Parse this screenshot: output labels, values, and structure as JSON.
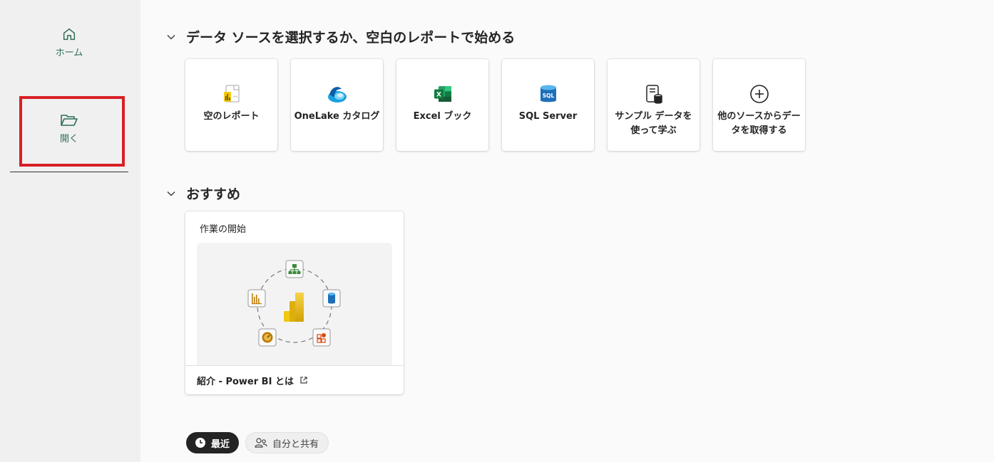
{
  "sidebar": {
    "items": [
      {
        "label": "ホーム",
        "icon": "home-icon"
      },
      {
        "label": "開く",
        "icon": "folder-open-icon"
      }
    ]
  },
  "sections": {
    "start": {
      "title": "データ ソースを選択するか、空白のレポートで始める"
    },
    "recommended": {
      "title": "おすすめ"
    }
  },
  "tiles": [
    {
      "label": "空のレポート",
      "icon": "blank-report-icon"
    },
    {
      "label": "OneLake カタログ",
      "icon": "onelake-icon"
    },
    {
      "label": "Excel ブック",
      "icon": "excel-icon"
    },
    {
      "label": "SQL Server",
      "icon": "sql-server-icon"
    },
    {
      "label": "サンプル データを使って学ぶ",
      "icon": "sample-data-icon"
    },
    {
      "label": "他のソースからデータを取得する",
      "icon": "add-circle-icon"
    }
  ],
  "recommended_card": {
    "title": "作業の開始",
    "footer": "紹介 - Power BI とは"
  },
  "pills": [
    {
      "label": "最近",
      "active": true,
      "icon": "clock-icon"
    },
    {
      "label": "自分と共有",
      "active": false,
      "icon": "people-icon"
    }
  ],
  "colors": {
    "accent_green": "#2f6f55",
    "highlight_red": "#d91f26",
    "excel_green": "#107c41",
    "sql_blue": "#1e6fb8",
    "powerbi_yellow": "#f2c811"
  }
}
